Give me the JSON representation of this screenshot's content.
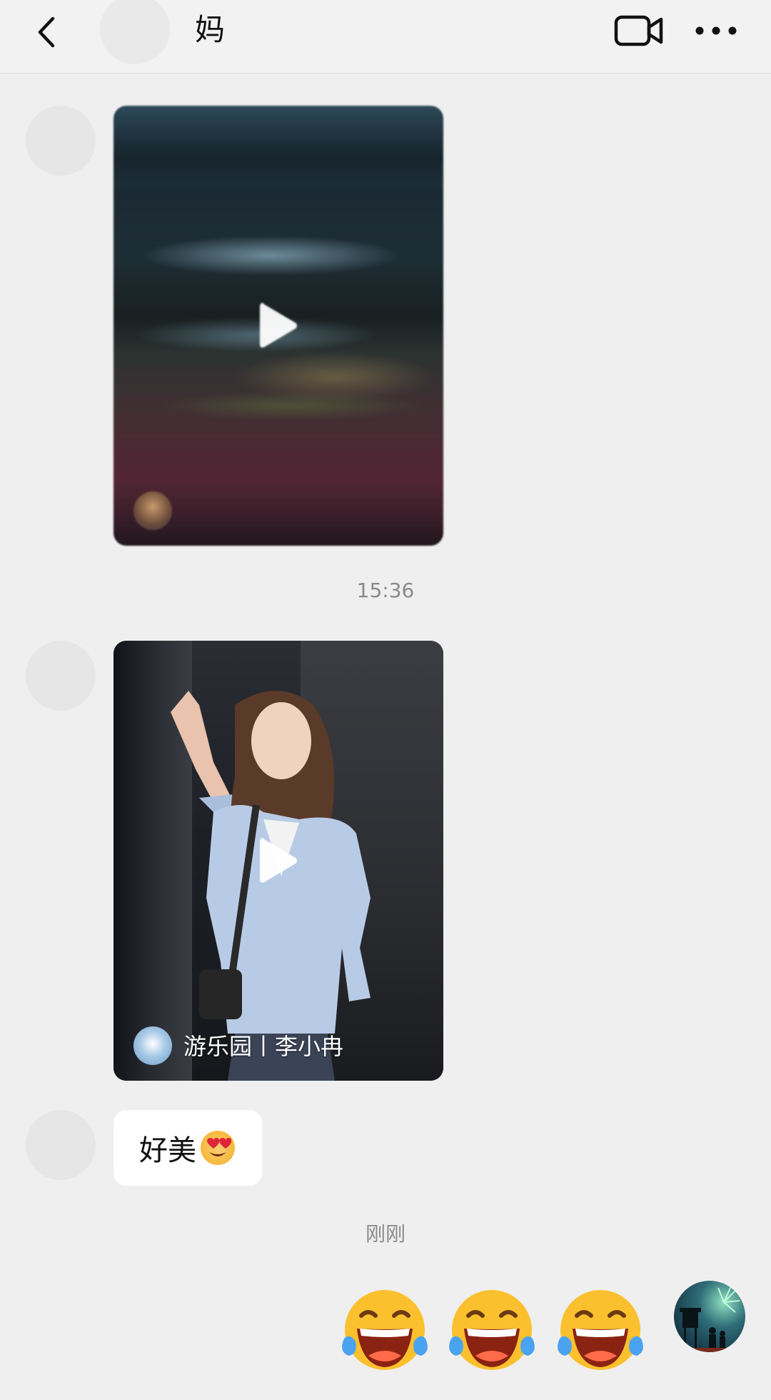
{
  "header": {
    "title": "妈",
    "back_icon": "chevron-left-icon",
    "video_call_icon": "video-camera-icon",
    "more_icon": "more-dots-icon"
  },
  "messages": [
    {
      "type": "video",
      "from": "other",
      "author_name": ""
    },
    {
      "type": "time",
      "text": "15:36"
    },
    {
      "type": "video",
      "from": "other",
      "author_name": "游乐园丨李小冉"
    },
    {
      "type": "text",
      "from": "other",
      "text": "好美",
      "emoji": "heart-eyes-emoji"
    },
    {
      "type": "time",
      "text": "刚刚"
    },
    {
      "type": "emoji",
      "from": "me",
      "emojis": [
        "tears-of-joy-emoji",
        "tears-of-joy-emoji",
        "tears-of-joy-emoji"
      ]
    }
  ],
  "colors": {
    "background": "#efefef",
    "bubble": "#ffffff",
    "timestamp": "#8a8a8a"
  }
}
